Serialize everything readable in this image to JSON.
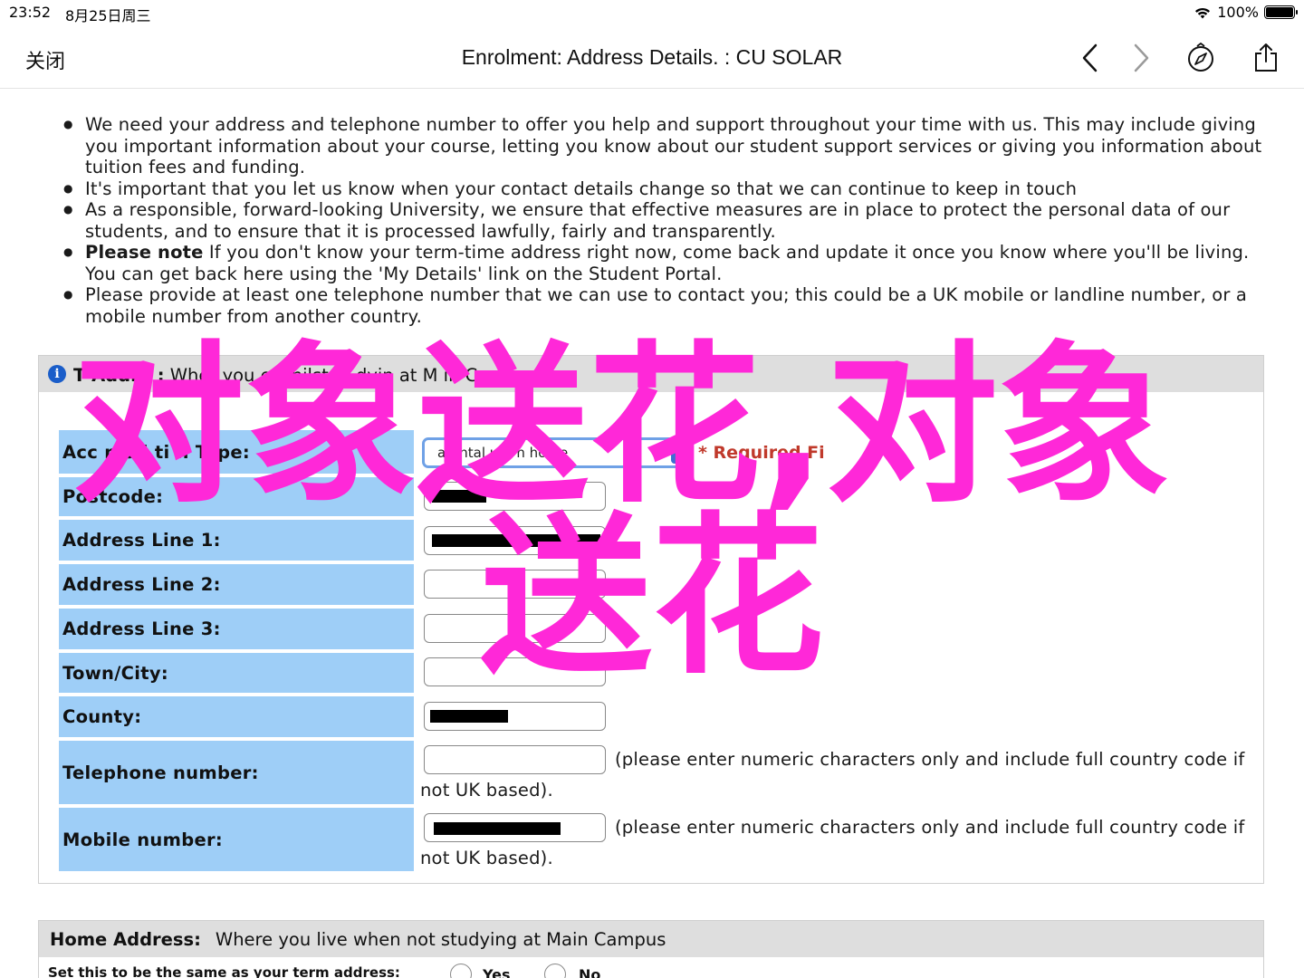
{
  "status_bar": {
    "time": "23:52",
    "date": "8月25日周三",
    "battery": "100%"
  },
  "nav": {
    "close_label": "关闭",
    "title": "Enrolment: Address Details. : CU SOLAR"
  },
  "intro": [
    "We need your address and telephone number to offer you help and support throughout your time with us. This may include giving you important information about your course, letting you know about our student support services or giving you information about tuition fees and funding.",
    "It's important that you let us know when your contact details change so that we can continue to keep in touch",
    "As a responsible, forward-looking University, we ensure that effective measures are in place to protect the personal data of our students, and to ensure that it is processed lawfully, fairly and transparently.",
    "Please provide at least one telephone number that we can use to contact you; this could be a UK mobile or landline number, or a mobile number from another country."
  ],
  "note": {
    "bold": "Please note",
    "text": " If you don't know your term-time address right now, come back and update it once you know where you'll be living. You can get back here using the 'My Details' link on the Student Portal."
  },
  "term_section": {
    "header_bold": "T  Addre  :",
    "header_text": " Wher  you  e whilst st  dyin  at M  in Campu",
    "labels": {
      "accommodation": "Acc   mod  ti  n Type:",
      "postcode": "Postcode:",
      "address1": "Address Line 1:",
      "address2": "Address Line 2:",
      "address3": "Address Line 3:",
      "town": "Town/City:",
      "county": "County:",
      "telephone": "Telephone number:",
      "mobile": "Mobile number:"
    },
    "select_value": "arental  uar  n home",
    "required": "* Required Fi",
    "hint_line1": "(please enter numeric characters only and include full country code if",
    "hint_line2": "not UK based)."
  },
  "home_section": {
    "header_bold": "Home Address:",
    "header_text": "Where you live when not studying at Main Campus",
    "same_label": "Set this to be the same as your term address:",
    "yes": "Yes",
    "no": "No"
  },
  "watermark": {
    "line1": "对象送花,对象",
    "line2": "送花"
  }
}
